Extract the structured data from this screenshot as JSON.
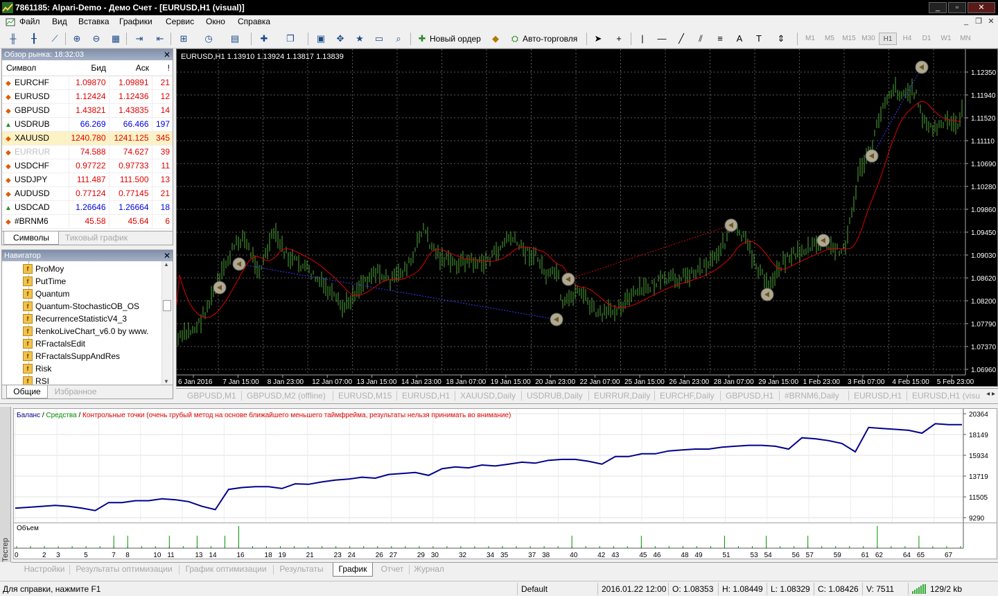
{
  "window": {
    "title": "7861185: Alpari-Demo - Демо Счет - [EURUSD,H1 (visual)]"
  },
  "menu": [
    "Файл",
    "Вид",
    "Вставка",
    "Графики",
    "Сервис",
    "Окно",
    "Справка"
  ],
  "toolbar": {
    "new_order_label": "Новый ордер",
    "autotrade_label": "Авто-торговля",
    "timeframes": [
      "M1",
      "M5",
      "M15",
      "M30",
      "H1",
      "H4",
      "D1",
      "W1",
      "MN"
    ],
    "active_timeframe": "H1"
  },
  "market_watch": {
    "title": "Обзор рынка: 18:32:03",
    "columns": [
      "Символ",
      "Бид",
      "Аск",
      "!"
    ],
    "rows": [
      {
        "symbol": "EURCHF",
        "bid": "1.09870",
        "ask": "1.09891",
        "spread": "21",
        "dir": "down",
        "color": "#e00000"
      },
      {
        "symbol": "EURUSD",
        "bid": "1.12424",
        "ask": "1.12436",
        "spread": "12",
        "dir": "down",
        "color": "#e00000"
      },
      {
        "symbol": "GBPUSD",
        "bid": "1.43821",
        "ask": "1.43835",
        "spread": "14",
        "dir": "down",
        "color": "#e00000"
      },
      {
        "symbol": "USDRUB",
        "bid": "66.269",
        "ask": "66.466",
        "spread": "197",
        "dir": "up",
        "color": "#0000e0"
      },
      {
        "symbol": "XAUUSD",
        "bid": "1240.780",
        "ask": "1241.125",
        "spread": "345",
        "dir": "down",
        "color": "#e00000",
        "selected": true
      },
      {
        "symbol": "EURRUR",
        "bid": "74.588",
        "ask": "74.627",
        "spread": "39",
        "dir": "down",
        "color": "#e00000",
        "dim": true
      },
      {
        "symbol": "USDCHF",
        "bid": "0.97722",
        "ask": "0.97733",
        "spread": "11",
        "dir": "down",
        "color": "#e00000"
      },
      {
        "symbol": "USDJPY",
        "bid": "111.487",
        "ask": "111.500",
        "spread": "13",
        "dir": "down",
        "color": "#e00000"
      },
      {
        "symbol": "AUDUSD",
        "bid": "0.77124",
        "ask": "0.77145",
        "spread": "21",
        "dir": "down",
        "color": "#e00000"
      },
      {
        "symbol": "USDCAD",
        "bid": "1.26646",
        "ask": "1.26664",
        "spread": "18",
        "dir": "up",
        "color": "#0000e0"
      },
      {
        "symbol": "#BRNM6",
        "bid": "45.58",
        "ask": "45.64",
        "spread": "6",
        "dir": "down",
        "color": "#e00000"
      }
    ],
    "tabs": [
      "Символы",
      "Тиковый график"
    ]
  },
  "navigator": {
    "title": "Навигатор",
    "items": [
      "ProMoy",
      "PutTime",
      "Quantum",
      "Quantum-StochasticOB_OS",
      "RecurrenceStatisticV4_3",
      "RenkoLiveChart_v6.0 by www.",
      "RFractalsEdit",
      "RFractalsSuppAndRes",
      "Risk",
      "RSI"
    ],
    "tabs": [
      "Общие",
      "Избранное"
    ]
  },
  "chart": {
    "header": "EURUSD,H1  1.13910 1.13924 1.13817 1.13839",
    "price_labels": [
      "1.12350",
      "1.11940",
      "1.11520",
      "1.11110",
      "1.10690",
      "1.10280",
      "1.09860",
      "1.09450",
      "1.09030",
      "1.08620",
      "1.08200",
      "1.07790",
      "1.07370",
      "1.06960"
    ],
    "time_labels": [
      "6 Jan 2016",
      "7 Jan 15:00",
      "8 Jan 23:00",
      "12 Jan 07:00",
      "13 Jan 15:00",
      "14 Jan 23:00",
      "18 Jan 07:00",
      "19 Jan 15:00",
      "20 Jan 23:00",
      "22 Jan 07:00",
      "25 Jan 15:00",
      "26 Jan 23:00",
      "28 Jan 07:00",
      "29 Jan 15:00",
      "1 Feb 23:00",
      "3 Feb 07:00",
      "4 Feb 15:00",
      "5 Feb 23:00"
    ],
    "colors": {
      "background": "#000000",
      "candles": "#4fa83a",
      "ma": "#e00000",
      "grid": "#5a5a5a"
    }
  },
  "chart_tabs": [
    "GBPUSD,M1",
    "GBPUSD,M2 (offline)",
    "EURUSD,M15",
    "EURUSD,H1",
    "XAUUSD,Daily",
    "USDRUB,Daily",
    "EURRUR,Daily",
    "EURCHF,Daily",
    "GBPUSD,H1",
    "#BRNM6,Daily",
    "EURUSD,H1",
    "EURUSD,H1 (visu"
  ],
  "tester": {
    "side_label": "Тестер",
    "legend": {
      "balance": "Баланс",
      "equity": "Средства",
      "checkpoints": "Контрольные точки (очень грубый метод на основе ближайшего меньшего таймфрейма, результаты нельзя принимать во внимание)",
      "sep": " / "
    },
    "volume_label": "Объем",
    "tabs": [
      "Настройки",
      "Результаты оптимизации",
      "График оптимизации",
      "Результаты",
      "График",
      "Отчет",
      "Журнал"
    ],
    "active_tab": "График"
  },
  "chart_data": {
    "type": "line",
    "title": "",
    "xlabel": "",
    "ylabel": "",
    "series": [
      {
        "name": "Баланс",
        "color": "#00008b"
      }
    ],
    "x": [
      0,
      1,
      2,
      3,
      4,
      5,
      6,
      7,
      8,
      9,
      10,
      11,
      12,
      13,
      14,
      15,
      16,
      17,
      18,
      19,
      20,
      21,
      22,
      23,
      24,
      25,
      26,
      27,
      28,
      29,
      30,
      31,
      32,
      33,
      34,
      35,
      36,
      37,
      38,
      39,
      40,
      41,
      42,
      43,
      44,
      45,
      46,
      47,
      48,
      49,
      50,
      51,
      52,
      53,
      54,
      55,
      56,
      57,
      58,
      59,
      60,
      61,
      62,
      63,
      64,
      65,
      66,
      67,
      68
    ],
    "values": [
      10300,
      10400,
      10500,
      10600,
      10500,
      10300,
      10050,
      10900,
      10900,
      11100,
      11100,
      11300,
      11200,
      11000,
      10500,
      10150,
      12300,
      12500,
      12600,
      12600,
      12400,
      12900,
      12850,
      13100,
      13300,
      13400,
      13600,
      13500,
      13900,
      14000,
      14100,
      13800,
      14500,
      14700,
      14600,
      14900,
      14800,
      15000,
      15200,
      15100,
      15400,
      15500,
      15500,
      15300,
      15000,
      15800,
      15800,
      16100,
      16100,
      16400,
      16500,
      16600,
      16600,
      16800,
      16900,
      17000,
      17000,
      16900,
      16600,
      17800,
      17700,
      17500,
      17200,
      16300,
      18900,
      18800,
      18700,
      18600,
      18300,
      19300,
      19200,
      19200
    ],
    "yticks": [
      20364,
      18149,
      15934,
      13719,
      11505,
      9290
    ],
    "ylim": [
      9290,
      20364
    ],
    "xticks": [
      0,
      2,
      3,
      5,
      7,
      8,
      10,
      11,
      13,
      14,
      16,
      18,
      19,
      21,
      23,
      24,
      26,
      27,
      29,
      30,
      32,
      34,
      35,
      37,
      38,
      40,
      42,
      43,
      45,
      46,
      48,
      49,
      51,
      53,
      54,
      56,
      57,
      59,
      61,
      62,
      64,
      65,
      67
    ],
    "volume_spikes": [
      7,
      8,
      11,
      13,
      15,
      16,
      40,
      45,
      51,
      54,
      57,
      62,
      65
    ],
    "volume_label": "Объем",
    "grid": true
  },
  "status": {
    "help": "Для справки, нажмите F1",
    "profile": "Default",
    "datetime": "2016.01.22 12:00",
    "open": "O: 1.08353",
    "high": "H: 1.08449",
    "low": "L: 1.08329",
    "close": "C: 1.08426",
    "volume": "V: 7511",
    "traffic": "129/2 kb"
  }
}
